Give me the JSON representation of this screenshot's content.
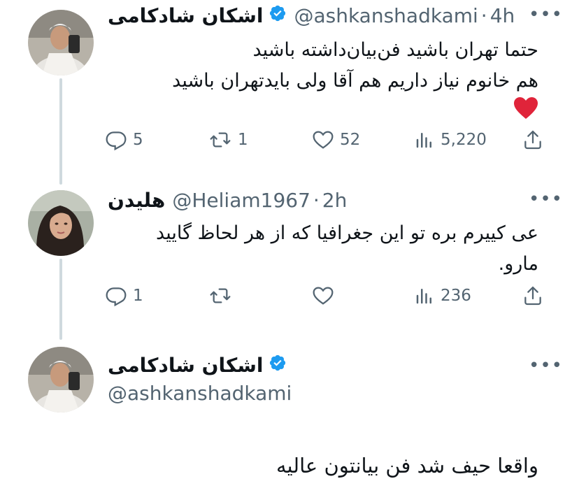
{
  "tweets": [
    {
      "name": "اشکان شادکامی",
      "handle": "@ashkanshadkami",
      "time": "4h",
      "lines": [
        "حتما تهران باشید فن‌بیان‌داشته باشید",
        "هم خانوم نیاز داریم هم آقا ولی بایدتهران باشید"
      ],
      "emoji": "❤️",
      "replies": "5",
      "retweets": "1",
      "likes": "52",
      "views": "5,220"
    },
    {
      "name": "هلیدن",
      "handle": "@Heliam1967",
      "time": "2h",
      "lines": [
        "عی کییرم بره تو این جغرافیا که از هر لحاظ گایید",
        "مارو."
      ],
      "replies": "1",
      "retweets": "",
      "likes": "",
      "views": "236"
    },
    {
      "name": "اشکان شادکامی",
      "handle": "@ashkanshadkami",
      "lines": [
        "واقعا حیف شد فن بیانتون عالیه"
      ]
    }
  ],
  "colors": {
    "verified": "#1d9bf0",
    "muted": "#536471",
    "thread_line": "#cfd9de",
    "heart": "#e0243a"
  },
  "icons": [
    "more-icon",
    "verified-badge-icon",
    "reply-icon",
    "retweet-icon",
    "like-icon",
    "views-icon",
    "share-icon"
  ]
}
